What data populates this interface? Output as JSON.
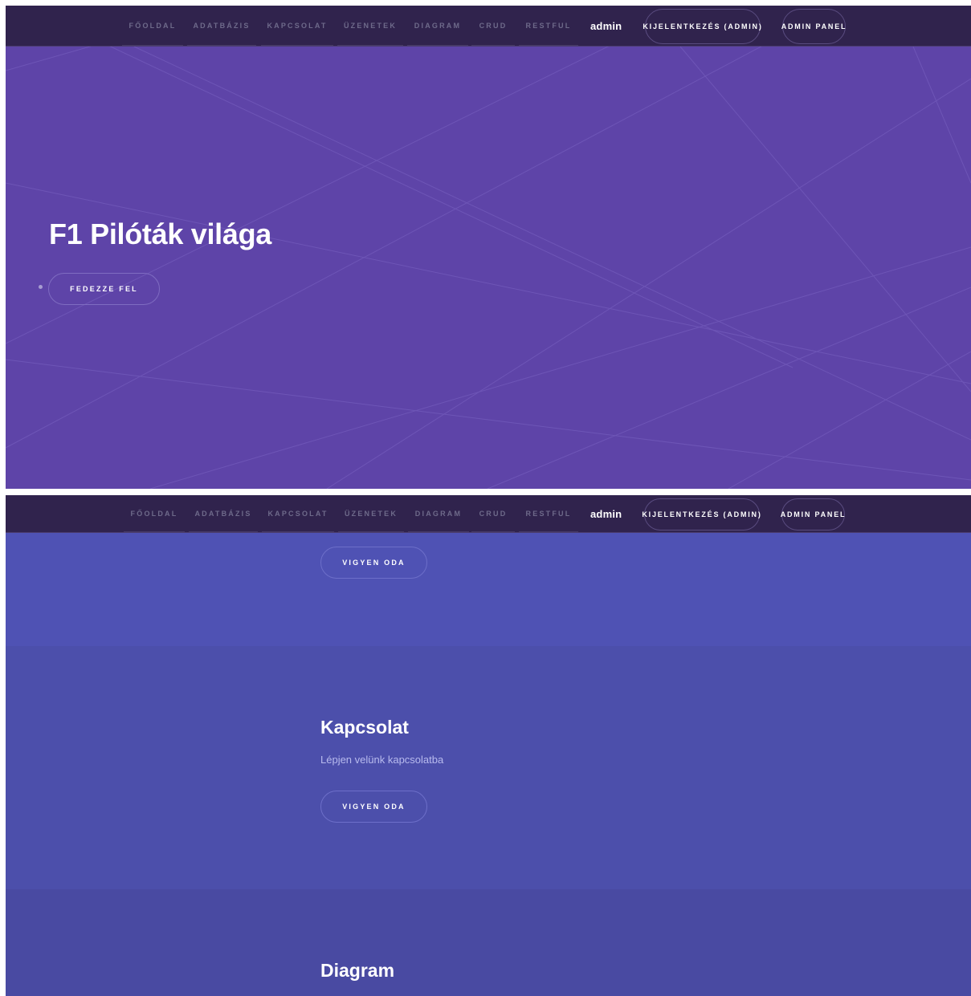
{
  "nav": {
    "items": [
      "Főoldal",
      "Adatbázis",
      "Kapcsolat",
      "Üzenetek",
      "Diagram",
      "CRUD",
      "RESTful"
    ],
    "user": "admin",
    "logout": "Kijelentkezés (admin)",
    "admin_panel": "Admin panel"
  },
  "hero": {
    "title": "F1 Pilóták világa",
    "button": "Fedezze fel"
  },
  "sections": {
    "first_button": "Vigyen oda",
    "contact": {
      "title": "Kapcsolat",
      "text": "Lépjen velünk kapcsolatba",
      "button": "Vigyen oda"
    },
    "diagram": {
      "title": "Diagram"
    }
  },
  "colors": {
    "navbar": "#30234d",
    "hero_bg": "#5e44a8",
    "section_a": "#4f52b4",
    "section_b": "#4c4fab",
    "section_c": "#494aa2"
  }
}
